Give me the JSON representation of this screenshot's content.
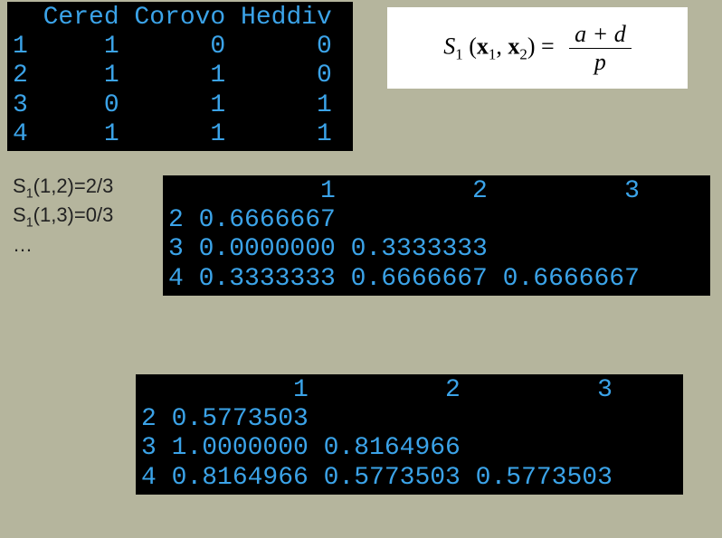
{
  "top_table": {
    "raw": "  Cered Corovo Heddiv\n1     1      0      0\n2     1      1      0\n3     0      1      1\n4     1      1      1",
    "headers": [
      "Cered",
      "Corovo",
      "Heddiv"
    ],
    "rows": [
      {
        "id": "1",
        "values": [
          1,
          0,
          0
        ]
      },
      {
        "id": "2",
        "values": [
          1,
          1,
          0
        ]
      },
      {
        "id": "3",
        "values": [
          0,
          1,
          1
        ]
      },
      {
        "id": "4",
        "values": [
          1,
          1,
          1
        ]
      }
    ]
  },
  "formula": {
    "lhs_symbol": "S",
    "lhs_sub": "1",
    "lhs_args_prefix": " (",
    "lhs_arg1": "x",
    "lhs_arg1_sub": "1",
    "lhs_sep": ", ",
    "lhs_arg2": "x",
    "lhs_arg2_sub": "2",
    "lhs_args_suffix": ")  = ",
    "numerator": "a + d",
    "denominator": "p",
    "plain": "S1(x1,x2) = (a + d) / p"
  },
  "notes": {
    "line1": "S",
    "line1_sub": "1",
    "line1_rest": "(1,2)=2/3",
    "line2": "S",
    "line2_sub": "1",
    "line2_rest": "(1,3)=0/3",
    "line3": "…"
  },
  "chart_data": [
    {
      "type": "table",
      "title": "Binary presence/absence matrix",
      "columns": [
        "Cered",
        "Corovo",
        "Heddiv"
      ],
      "rows": [
        "1",
        "2",
        "3",
        "4"
      ],
      "values": [
        [
          1,
          0,
          0
        ],
        [
          1,
          1,
          0
        ],
        [
          0,
          1,
          1
        ],
        [
          1,
          1,
          1
        ]
      ]
    },
    {
      "type": "table",
      "title": "Lower-triangular S1 similarity matrix",
      "columns": [
        "1",
        "2",
        "3"
      ],
      "rows": [
        "2",
        "3",
        "4"
      ],
      "values": [
        [
          0.6666667,
          null,
          null
        ],
        [
          0.0,
          0.3333333,
          null
        ],
        [
          0.3333333,
          0.6666667,
          0.6666667
        ]
      ]
    },
    {
      "type": "table",
      "title": "Lower-triangular distance matrix",
      "columns": [
        "1",
        "2",
        "3"
      ],
      "rows": [
        "2",
        "3",
        "4"
      ],
      "values": [
        [
          0.5773503,
          null,
          null
        ],
        [
          1.0,
          0.8164966,
          null
        ],
        [
          0.8164966,
          0.5773503,
          0.5773503
        ]
      ]
    }
  ],
  "mid_table": {
    "raw": "          1         2         3\n2 0.6666667\n3 0.0000000 0.3333333\n4 0.3333333 0.6666667 0.6666667"
  },
  "bot_table": {
    "raw": "          1         2         3\n2 0.5773503\n3 1.0000000 0.8164966\n4 0.8164966 0.5773503 0.5773503"
  }
}
